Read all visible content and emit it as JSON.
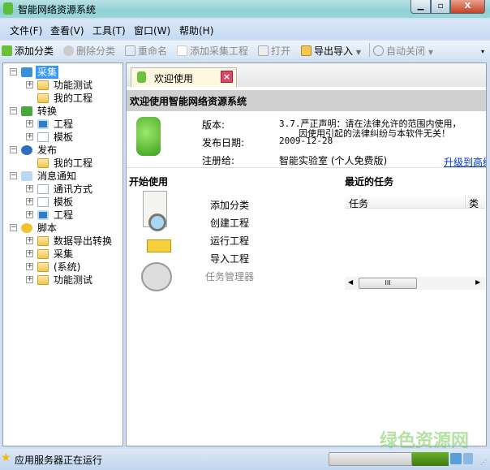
{
  "window": {
    "title": "智能网络资源系统",
    "controls": [
      "minimize",
      "maximize",
      "close"
    ]
  },
  "menu": [
    "文件(F)",
    "查看(V)",
    "工具(T)",
    "窗口(W)",
    "帮助(H)"
  ],
  "toolbar": {
    "add_category": "添加分类",
    "delete_category": "删除分类",
    "rename": "重命名",
    "add_project": "添加采集工程",
    "open": "打开",
    "export_import": "导出导入",
    "auto_close": "自动关闭"
  },
  "tree": [
    {
      "label": "采集",
      "children": [
        "功能测试",
        "我的工程"
      ]
    },
    {
      "label": "转换",
      "children": [
        "工程",
        "模板"
      ]
    },
    {
      "label": "发布",
      "children": [
        "我的工程"
      ]
    },
    {
      "label": "消息通知",
      "children": [
        "通讯方式",
        "模板",
        "工程"
      ]
    },
    {
      "label": "脚本",
      "children": [
        "数据导出转换",
        "采集",
        "(系统)",
        "功能测试"
      ]
    }
  ],
  "tab": {
    "label": "欢迎使用"
  },
  "welcome": {
    "heading": "欢迎使用智能网络资源系统",
    "version_label": "版本:",
    "version_value": "3.7.严正声明：请在法律允许的范围内使用，",
    "version_value2": "因使用引起的法律纠纷与本软件无关！",
    "date_label": "发布日期:",
    "date_value": "2009-12-28",
    "reg_label": "注册给:",
    "reg_value": "智能实验室 (个人免费版)",
    "upgrade_link": "升级到高级"
  },
  "start": {
    "title": "开始使用",
    "items": [
      "添加分类",
      "创建工程",
      "运行工程",
      "导入工程",
      "任务管理器"
    ]
  },
  "recent": {
    "title": "最近的任务",
    "columns": [
      "任务",
      "类型"
    ]
  },
  "status": {
    "text": "应用服务器正在运行"
  },
  "watermark": "绿色资源网"
}
